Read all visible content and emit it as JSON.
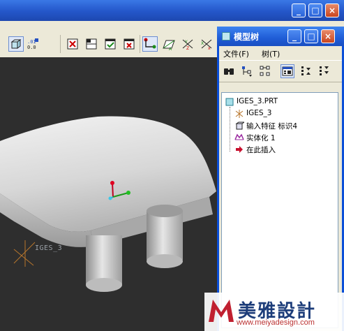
{
  "main_window": {
    "minimize_label": "_",
    "maximize_label": "□",
    "close_label": "×"
  },
  "toolbar": {
    "icons": [
      "solid-view-icon",
      "zoom-ratio-icon",
      "datum-plane-toggle-icon",
      "datum-axis-toggle-icon",
      "model-tree-toggle-icon",
      "csys-toggle-icon",
      "spin-center-icon",
      "datum-plane-icon",
      "datum-axis-icon",
      "datum-point-icon"
    ]
  },
  "viewport": {
    "model_label": "IGES_3"
  },
  "model_tree": {
    "title": "模型树",
    "menu": {
      "file": "文件(F)",
      "tree": "树(T)"
    },
    "tools": [
      "find-icon",
      "show-icon",
      "settings-icon",
      "columns-icon",
      "expand-icon",
      "collapse-icon"
    ],
    "root": "IGES_3.PRT",
    "items": [
      {
        "label": "IGES_3",
        "icon": "csys-icon"
      },
      {
        "label": "输入特征 标识4",
        "icon": "import-feature-icon"
      },
      {
        "label": "实体化 1",
        "icon": "solidify-icon"
      },
      {
        "label": "在此插入",
        "icon": "insert-here-arrow-icon"
      }
    ]
  },
  "watermark": {
    "brand": "美雅設計",
    "url": "www.meiyadesign.com"
  },
  "colors": {
    "titlebar": "#2456c9",
    "panel_bg": "#ece9d8",
    "viewport_bg": "#2e2e2e"
  }
}
